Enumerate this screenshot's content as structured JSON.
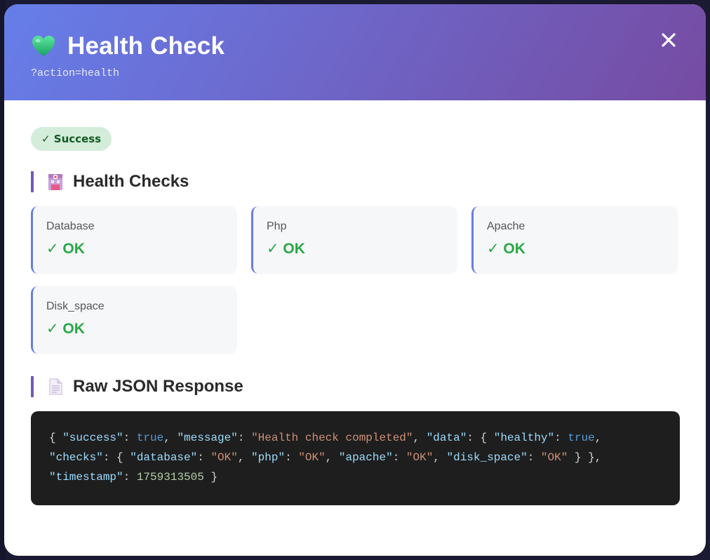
{
  "header": {
    "title": "Health Check",
    "subtitle": "?action=health",
    "close_label": "×"
  },
  "status_badge": "✓ Success",
  "sections": {
    "checks_title": "Health Checks",
    "json_title": "Raw JSON Response"
  },
  "checks": [
    {
      "name": "Database",
      "status": "✓ OK"
    },
    {
      "name": "Php",
      "status": "✓ OK"
    },
    {
      "name": "Apache",
      "status": "✓ OK"
    },
    {
      "name": "Disk_space",
      "status": "✓ OK"
    }
  ],
  "raw_json": {
    "success_key": "\"success\"",
    "success_val": "true",
    "message_key": "\"message\"",
    "message_val": "\"Health check completed\"",
    "data_key": "\"data\"",
    "healthy_key": "\"healthy\"",
    "healthy_val": "true",
    "checks_key": "\"checks\"",
    "database_key": "\"database\"",
    "database_val": "\"OK\"",
    "php_key": "\"php\"",
    "php_val": "\"OK\"",
    "apache_key": "\"apache\"",
    "apache_val": "\"OK\"",
    "disk_key": "\"disk_space\"",
    "disk_val": "\"OK\"",
    "timestamp_key": "\"timestamp\"",
    "timestamp_val": "1759313505"
  },
  "colors": {
    "header_gradient_start": "#667eea",
    "header_gradient_end": "#764ba2",
    "success_green": "#28a745",
    "badge_bg": "#d4edda",
    "code_bg": "#1e1e1e"
  },
  "icons": {
    "title": "green-heart-icon",
    "close": "close-icon",
    "checks_section": "hospital-icon",
    "json_section": "document-icon"
  }
}
